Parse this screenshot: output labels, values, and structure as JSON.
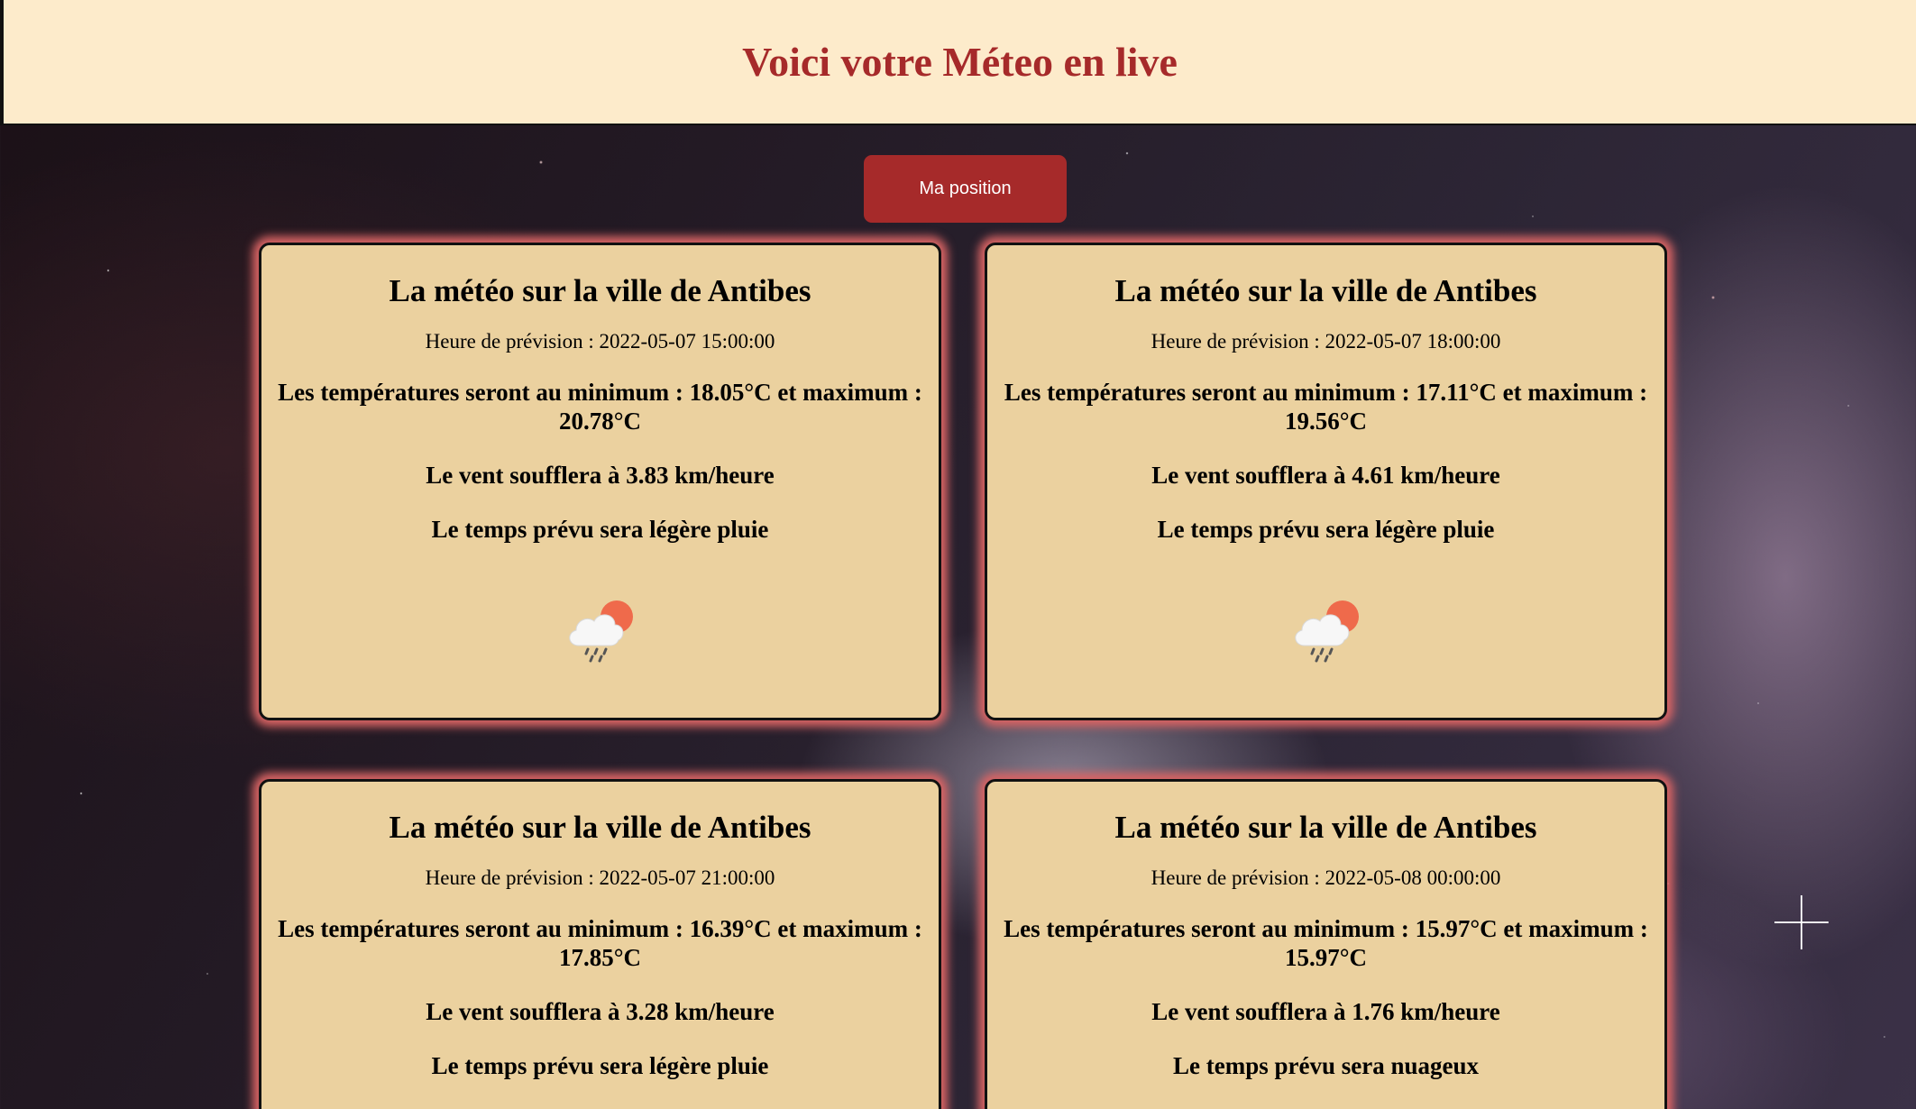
{
  "header": {
    "title": "Voici votre Méteo en live"
  },
  "toolbar": {
    "position_label": "Ma position"
  },
  "colors": {
    "header_bg": "#fdebcb",
    "title_red": "#a62a2a",
    "card_bg": "#ebd19f",
    "card_glow": "#d86464"
  },
  "forecasts": [
    {
      "title": "La météo sur la ville de Antibes",
      "time": "Heure de prévision : 2022-05-07 15:00:00",
      "temperature": "Les températures seront au minimum : 18.05°C et maximum : 20.78°C",
      "wind": "Le vent soufflera à 3.83 km/heure",
      "description": "Le temps prévu sera légère pluie",
      "icon": "light-rain-cloud-sun-icon"
    },
    {
      "title": "La météo sur la ville de Antibes",
      "time": "Heure de prévision : 2022-05-07 18:00:00",
      "temperature": "Les températures seront au minimum : 17.11°C et maximum : 19.56°C",
      "wind": "Le vent soufflera à 4.61 km/heure",
      "description": "Le temps prévu sera légère pluie",
      "icon": "light-rain-cloud-sun-icon"
    },
    {
      "title": "La météo sur la ville de Antibes",
      "time": "Heure de prévision : 2022-05-07 21:00:00",
      "temperature": "Les températures seront au minimum : 16.39°C et maximum : 17.85°C",
      "wind": "Le vent soufflera à 3.28 km/heure",
      "description": "Le temps prévu sera légère pluie"
    },
    {
      "title": "La météo sur la ville de Antibes",
      "time": "Heure de prévision : 2022-05-08 00:00:00",
      "temperature": "Les températures seront au minimum : 15.97°C et maximum : 15.97°C",
      "wind": "Le vent soufflera à 1.76 km/heure",
      "description": "Le temps prévu sera nuageux"
    }
  ]
}
